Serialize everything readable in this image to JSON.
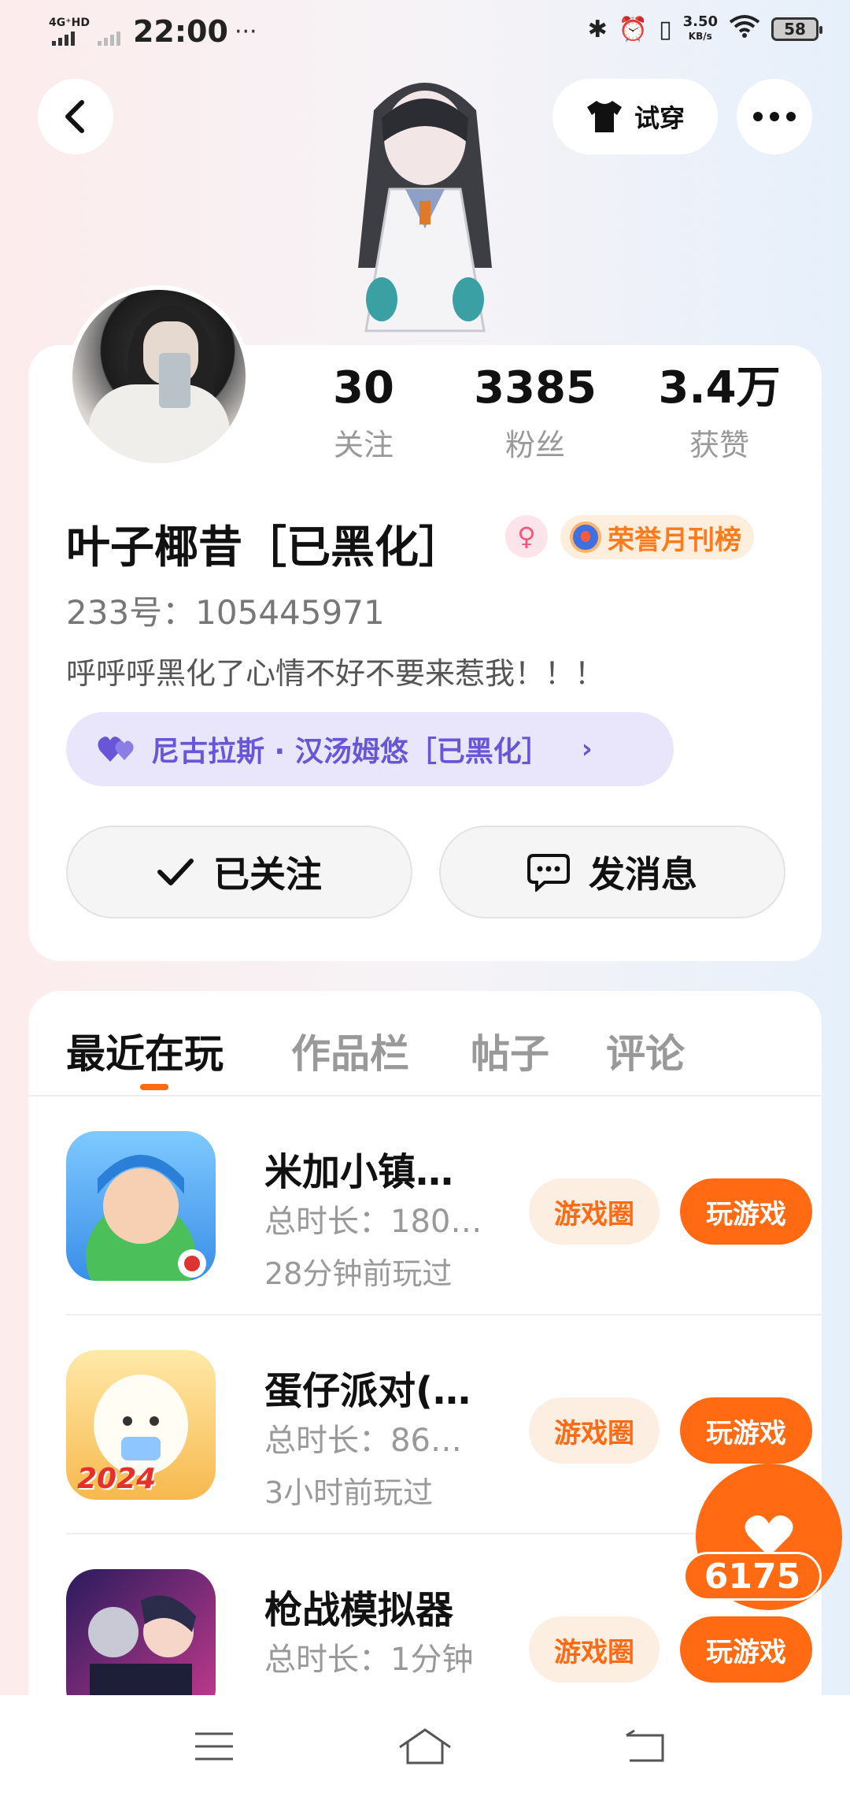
{
  "status_bar": {
    "network": "4G⁺HD",
    "time": "22:00",
    "more": "···",
    "speed_value": "3.50",
    "speed_unit": "KB/s",
    "battery": "58"
  },
  "header": {
    "try_on_label": "试穿"
  },
  "profile": {
    "stats": [
      {
        "value": "30",
        "label": "关注"
      },
      {
        "value": "3385",
        "label": "粉丝"
      },
      {
        "value": "3.4万",
        "label": "获赞"
      }
    ],
    "nickname": "叶子椰昔［已黑化］",
    "gender_symbol": "♀",
    "honor_badge": "荣誉月刊榜",
    "uid": "233号：105445971",
    "bio": "呼呼呼黑化了心情不好不要来惹我！！！",
    "cp_label": "尼古拉斯 · 汉汤姆悠［已黑化］",
    "follow_label": "已关注",
    "message_label": "发消息"
  },
  "tabs": [
    "最近在玩",
    "作品栏",
    "帖子",
    "评论"
  ],
  "games": [
    {
      "name": "米加小镇…",
      "duration": "总时长：180…",
      "last_played": "28分钟前玩过",
      "circle_label": "游戏圈",
      "play_label": "玩游戏"
    },
    {
      "name": "蛋仔派对(…",
      "duration": "总时长：86…",
      "last_played": "3小时前玩过",
      "circle_label": "游戏圈",
      "play_label": "玩游戏",
      "icon_text": "2024"
    },
    {
      "name": "枪战模拟器",
      "duration": "总时长：1分钟",
      "last_played": "",
      "circle_label": "游戏圈",
      "play_label": "玩游戏"
    }
  ],
  "like": {
    "count": "6175"
  },
  "colors": {
    "accent": "#ff6a13",
    "cp_text": "#6757d6",
    "cp_bg": "#e9e6fb"
  }
}
